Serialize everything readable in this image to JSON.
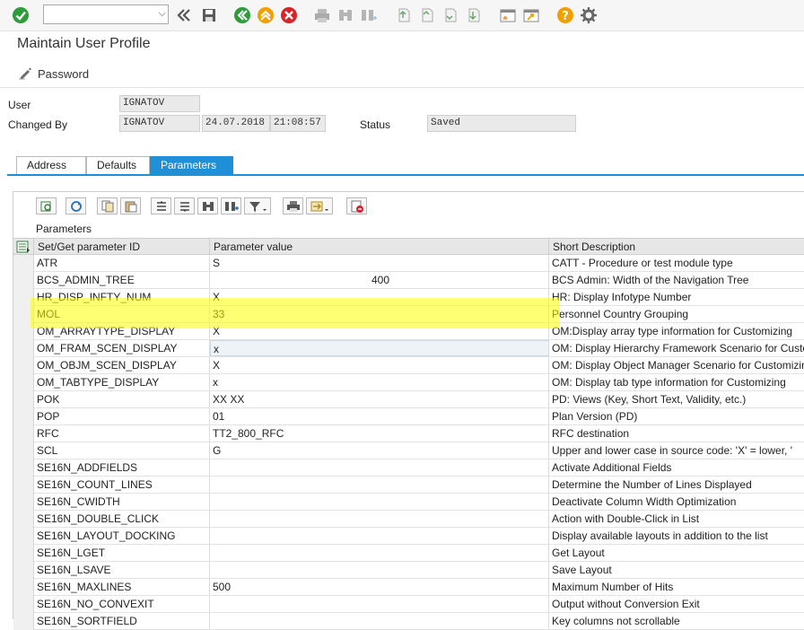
{
  "toolbar": {
    "command_field_value": "",
    "icons": [
      "enter-check-icon",
      "dropdown-chevron-icon",
      "double-left-icon",
      "save-icon",
      "back-icon",
      "exit-icon",
      "cancel-icon",
      "print-icon",
      "find-icon",
      "find-next-icon",
      "first-page-icon",
      "prev-page-icon",
      "next-page-icon",
      "last-page-icon",
      "create-session-icon",
      "shortcut-icon",
      "help-icon",
      "settings-icon"
    ]
  },
  "page": {
    "title": "Maintain User Profile",
    "password_button": "Password"
  },
  "header_fields": {
    "user_label": "User",
    "user_value": "IGNATOV",
    "changed_by_label": "Changed By",
    "changed_by_value": "IGNATOV",
    "changed_date": "24.07.2018",
    "changed_time": "21:08:57",
    "status_label": "Status",
    "status_value": "Saved"
  },
  "tabs": [
    {
      "label": "Address"
    },
    {
      "label": "Defaults"
    },
    {
      "label": "Parameters",
      "active": true
    }
  ],
  "accent_color": "#1f8fd8",
  "highlight_color": "#ffff00",
  "grid": {
    "caption": "Parameters",
    "columns": [
      "Set/Get parameter ID",
      "Parameter value",
      "Short Description"
    ],
    "rows": [
      {
        "id": "ATR",
        "value": "S",
        "desc": "CATT - Procedure or test module type"
      },
      {
        "id": "BCS_ADMIN_TREE",
        "value": "400",
        "desc": "BCS Admin: Width of the Navigation Tree"
      },
      {
        "id": "HR_DISP_INFTY_NUM",
        "value": "X",
        "desc": "HR: Display Infotype Number"
      },
      {
        "id": "MOL",
        "value": "33",
        "desc": "Personnel Country Grouping"
      },
      {
        "id": "OM_ARRAYTYPE_DISPLAY",
        "value": "X",
        "desc": "OM:Display array type information for Customizing"
      },
      {
        "id": "OM_FRAM_SCEN_DISPLAY",
        "value": "x",
        "desc": "OM: Display Hierarchy Framework Scenario for Custo"
      },
      {
        "id": "OM_OBJM_SCEN_DISPLAY",
        "value": "X",
        "desc": "OM: Display Object Manager Scenario for Customizin"
      },
      {
        "id": "OM_TABTYPE_DISPLAY",
        "value": "x",
        "desc": "OM: Display tab type information for Customizing"
      },
      {
        "id": "POK",
        "value": "XX      XX",
        "desc": "PD: Views (Key, Short Text, Validity, etc.)"
      },
      {
        "id": "POP",
        "value": "01",
        "desc": "Plan Version (PD)"
      },
      {
        "id": "RFC",
        "value": "TT2_800_RFC",
        "desc": "RFC destination"
      },
      {
        "id": "SCL",
        "value": "G",
        "desc": "Upper and lower case in source code: 'X' = lower, '"
      },
      {
        "id": "SE16N_ADDFIELDS",
        "value": "",
        "desc": "Activate Additional Fields"
      },
      {
        "id": "SE16N_COUNT_LINES",
        "value": "",
        "desc": "Determine the Number of Lines Displayed"
      },
      {
        "id": "SE16N_CWIDTH",
        "value": "",
        "desc": "Deactivate Column Width Optimization"
      },
      {
        "id": "SE16N_DOUBLE_CLICK",
        "value": "",
        "desc": "Action with Double-Click in List"
      },
      {
        "id": "SE16N_LAYOUT_DOCKING",
        "value": "",
        "desc": "Display available layouts in addition to the list"
      },
      {
        "id": "SE16N_LGET",
        "value": "",
        "desc": "Get Layout"
      },
      {
        "id": "SE16N_LSAVE",
        "value": "",
        "desc": "Save Layout"
      },
      {
        "id": "SE16N_MAXLINES",
        "value": "500",
        "desc": "Maximum Number of Hits"
      },
      {
        "id": "SE16N_NO_CONVEXIT",
        "value": "",
        "desc": "Output without Conversion Exit"
      },
      {
        "id": "SE16N_SORTFIELD",
        "value": "",
        "desc": "Key columns not scrollable"
      }
    ]
  }
}
